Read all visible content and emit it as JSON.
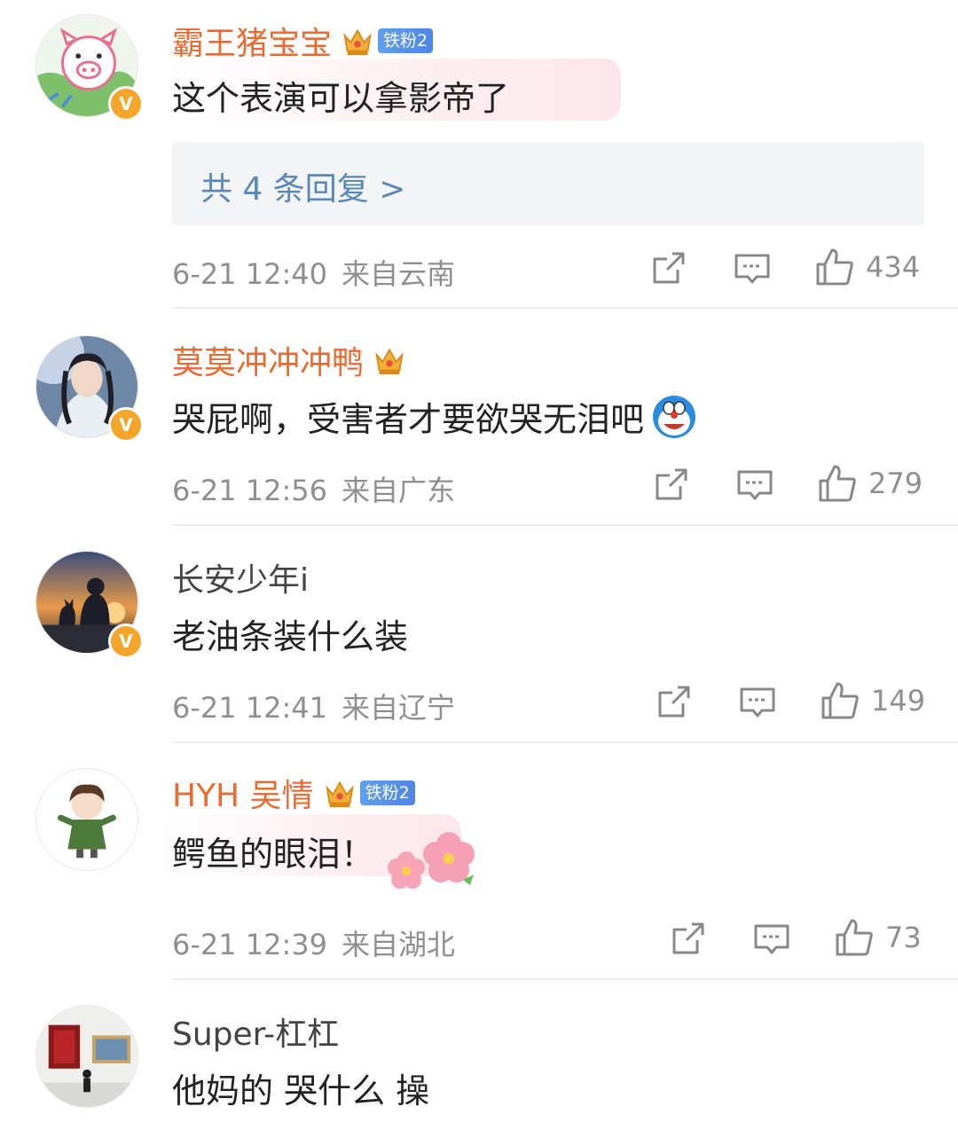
{
  "comments": [
    {
      "username": "霸王猪宝宝",
      "fan_badge": "铁粉2",
      "text": "这个表演可以拿影帝了",
      "replies_label": "共 4 条回复 >",
      "time": "6-21 12:40",
      "location": "来自云南",
      "likes": "434",
      "verified_mark": "V"
    },
    {
      "username": "莫莫冲冲冲鸭",
      "text": "哭屁啊，受害者才要欲哭无泪吧",
      "time": "6-21 12:56",
      "location": "来自广东",
      "likes": "279",
      "verified_mark": "V"
    },
    {
      "username": "长安少年i",
      "text": "老油条装什么装",
      "time": "6-21 12:41",
      "location": "来自辽宁",
      "likes": "149",
      "verified_mark": "V"
    },
    {
      "username": "HYH 吴情",
      "fan_badge": "铁粉2",
      "text": "鳄鱼的眼泪！",
      "time": "6-21 12:39",
      "location": "来自湖北",
      "likes": "73"
    },
    {
      "username": "Super-杠杠",
      "text": "他妈的 哭什么 操"
    }
  ],
  "icons": {
    "share": "share-icon",
    "comment": "comment-icon",
    "like": "thumbs-up-icon",
    "crown": "crown-badge-icon",
    "emoji": "doraemon-emoji-icon",
    "sticker": "flower-sticker-icon"
  },
  "colors": {
    "username_vip": "#ea6a32",
    "reply_link": "#5a87b5",
    "meta_gray": "#8f8f8f",
    "verified_badge": "#f4a52a"
  }
}
